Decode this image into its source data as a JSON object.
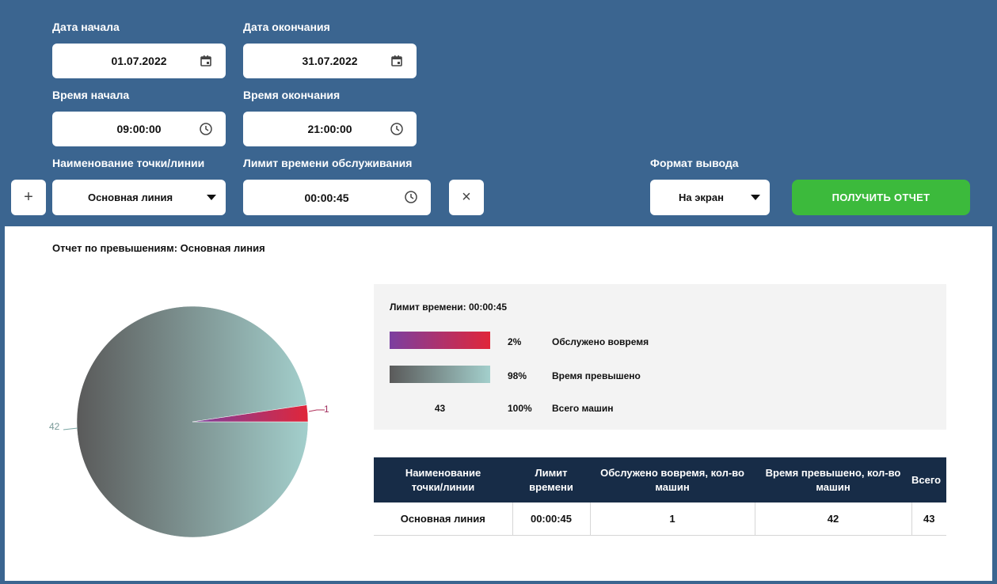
{
  "filters": {
    "start_date": {
      "label": "Дата начала",
      "value": "01.07.2022",
      "icon": "calendar-icon"
    },
    "end_date": {
      "label": "Дата окончания",
      "value": "31.07.2022",
      "icon": "calendar-icon"
    },
    "start_time": {
      "label": "Время начала",
      "value": "09:00:00",
      "icon": "clock-icon"
    },
    "end_time": {
      "label": "Время окончания",
      "value": "21:00:00",
      "icon": "clock-icon"
    },
    "point": {
      "label": "Наименование точки/линии",
      "value": "Основная линия",
      "add_label": "+"
    },
    "limit": {
      "label": "Лимит времени обслуживания",
      "value": "00:00:45",
      "clear_label": "×"
    },
    "format": {
      "label": "Формат вывода",
      "value": "На экран"
    },
    "submit_label": "ПОЛУЧИТЬ ОТЧЕТ"
  },
  "report": {
    "title": "Отчет по превышениям: Основная линия",
    "legend": {
      "title": "Лимит времени: 00:00:45",
      "items": [
        {
          "pct": "2%",
          "label": "Обслужено вовремя"
        },
        {
          "pct": "98%",
          "label": "Время превышено"
        }
      ],
      "total_count": "43",
      "total_pct": "100%",
      "total_label": "Всего машин"
    },
    "table": {
      "headers": [
        "Наименование точки/линии",
        "Лимит времени",
        "Обслужено вовремя, кол-во машин",
        "Время превышено, кол-во машин",
        "Всего"
      ],
      "rows": [
        [
          "Основная линия",
          "00:00:45",
          "1",
          "42",
          "43"
        ]
      ]
    }
  },
  "chart_data": {
    "type": "pie",
    "slices": [
      {
        "value": 1,
        "label": "1"
      },
      {
        "value": 42,
        "label": "42"
      }
    ],
    "title": "",
    "legend": "none"
  },
  "colors": {
    "header_bg": "#3b6590",
    "accent_green": "#3cba3c",
    "table_header": "#172c47",
    "on_time_gradient": [
      "#7b3fa0",
      "#e0263a"
    ],
    "exceeded_gradient": [
      "#5a5a5a",
      "#a3cfcc"
    ]
  }
}
